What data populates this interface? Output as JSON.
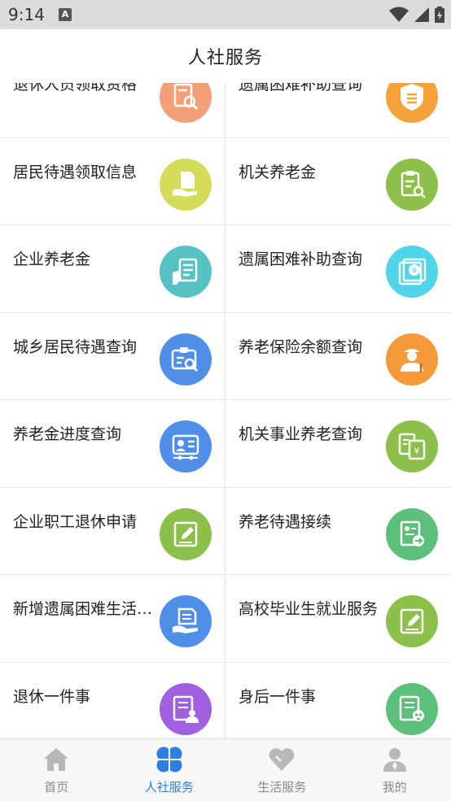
{
  "status_bar": {
    "time": "9:14",
    "notification_badge": "A"
  },
  "header": {
    "title": "人社服务"
  },
  "colors": {
    "accent_blue": "#2f7fe0",
    "inactive_gray": "#b8b8b8"
  },
  "rows": [
    {
      "left": {
        "label": "退休人员领取资格",
        "icon": "doc-search-icon",
        "color": "#f2a07a"
      },
      "right": {
        "label": "遗属困难补助查询",
        "icon": "shield-doc-icon",
        "color": "#f5a23a"
      }
    },
    {
      "left": {
        "label": "居民待遇领取信息",
        "icon": "hand-document-icon",
        "color": "#d4dc5a"
      },
      "right": {
        "label": "机关养老金",
        "icon": "clipboard-search-icon",
        "color": "#8cc04a"
      }
    },
    {
      "left": {
        "label": "企业养老金",
        "icon": "hand-form-icon",
        "color": "#56c2c2"
      },
      "right": {
        "label": "遗属困难补助查询",
        "icon": "yuan-bill-icon",
        "color": "#4fd4e8"
      }
    },
    {
      "left": {
        "label": "城乡居民待遇查询",
        "icon": "id-search-icon",
        "color": "#4f8fe8"
      },
      "right": {
        "label": "养老保险余额查询",
        "icon": "elder-person-icon",
        "color": "#f59a3a"
      }
    },
    {
      "left": {
        "label": "养老金进度查询",
        "icon": "id-card-progress-icon",
        "color": "#4f8fe8"
      },
      "right": {
        "label": "机关事业养老查询",
        "icon": "yuan-documents-icon",
        "color": "#8cc04a"
      }
    },
    {
      "left": {
        "label": "企业职工退休申请",
        "icon": "edit-document-icon",
        "color": "#8cc04a"
      },
      "right": {
        "label": "养老待遇接续",
        "icon": "transfer-document-icon",
        "color": "#5cc07a"
      }
    },
    {
      "left": {
        "label": "新增遗属困难生活补助",
        "icon": "hand-files-icon",
        "color": "#4f8fe8"
      },
      "right": {
        "label": "高校毕业生就业服务",
        "icon": "edit-document-icon",
        "color": "#8cc04a"
      }
    },
    {
      "left": {
        "label": "退休一件事",
        "icon": "retiree-document-icon",
        "color": "#a060e0"
      },
      "right": {
        "label": "身后一件事",
        "icon": "skull-document-icon",
        "color": "#5cc07a"
      }
    }
  ],
  "tabs": [
    {
      "label": "首页",
      "icon": "home-icon",
      "active": false
    },
    {
      "label": "人社服务",
      "icon": "grid-clover-icon",
      "active": true
    },
    {
      "label": "生活服务",
      "icon": "heart-icon",
      "active": false
    },
    {
      "label": "我的",
      "icon": "person-icon",
      "active": false
    }
  ]
}
